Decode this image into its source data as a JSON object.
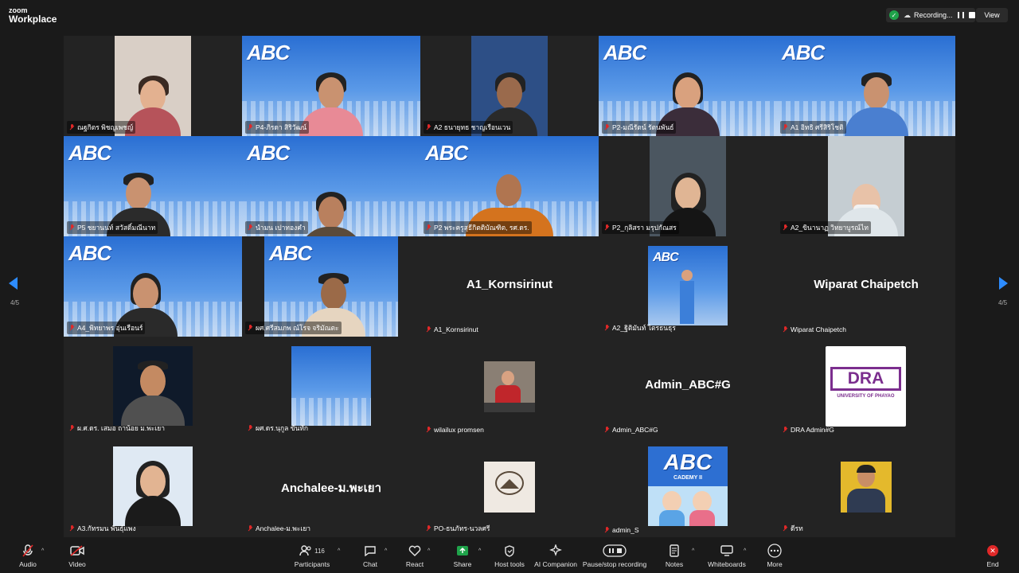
{
  "app": {
    "logo_top": "zoom",
    "logo_bottom": "Workplace"
  },
  "recording": {
    "label": "Recording...",
    "view_label": "View"
  },
  "pagination": {
    "left": "4/5",
    "right": "4/5"
  },
  "tiles": [
    {
      "name": "ณฐกิตร พิชญเพชญ์",
      "kind": "cam"
    },
    {
      "name": "P4-ภิรดา สิริวัฒน์",
      "kind": "abc"
    },
    {
      "name": "A2 ธนายุทธ ชาญเรือนเวน",
      "kind": "cam"
    },
    {
      "name": "P2-มณีรัตน์ รัตนพันธ์",
      "kind": "abc"
    },
    {
      "name": "A1 อิทธิ ศรีสิริโชติ",
      "kind": "abc"
    },
    {
      "name": "P5 ชยานนท์ สวัสดิ์มณีนาท",
      "kind": "abc"
    },
    {
      "name": "นำมน เปาทองคำ",
      "kind": "abc"
    },
    {
      "name": "P2 พระครูสุธีกิตติบัณฑิต, รศ.ดร.",
      "kind": "abc"
    },
    {
      "name": "P2_กุลิสรา มรุปกัณสร",
      "kind": "cam"
    },
    {
      "name": "A2_ขินานาฏ วิทยาบูรณ์ไท",
      "kind": "cam"
    },
    {
      "name": "A4_พิทยาพร อุ่นเรือนร์",
      "kind": "abc"
    },
    {
      "name": "ผศ.ศรีสมภพ ณ์โรจ จริมัณตะ",
      "kind": "abc"
    },
    {
      "name": "A1_Kornsirinut",
      "kind": "text",
      "big": "A1_Kornsirinut"
    },
    {
      "name": "A2_ฐิติมันท์ ไตรธนธุร",
      "kind": "small"
    },
    {
      "name": "Wiparat Chaipetch",
      "kind": "text",
      "big": "Wiparat Chaipetch"
    },
    {
      "name": "ผ.ศ.ดร. เสมอ ถาน้อย ม.พะเยา",
      "kind": "small"
    },
    {
      "name": "ผศ.ดร.นุกูล ขันทัก",
      "kind": "small"
    },
    {
      "name": "wilailux promsen",
      "kind": "small"
    },
    {
      "name": "Admin_ABC#G",
      "kind": "text",
      "big": "Admin_ABC#G"
    },
    {
      "name": "DRA Admin#G",
      "kind": "small"
    },
    {
      "name": "A3.กัทรมน พันธุ์แพง",
      "kind": "small"
    },
    {
      "name": "Anchalee-ม.พะเยา",
      "kind": "text",
      "big": "Anchalee-ม.พะเยา"
    },
    {
      "name": "PO-ธนภัทร-นวลศรี",
      "kind": "small"
    },
    {
      "name": "admin_S",
      "kind": "small"
    },
    {
      "name": "ดีรท",
      "kind": "small"
    }
  ],
  "logos": {
    "abc": "ABC",
    "dra": "DRA",
    "dra_sub": "UNIVERSITY OF PHAYAO",
    "abc2": "ABC",
    "abc2_sub": "CADEMY II"
  },
  "toolbar": {
    "audio": "Audio",
    "video": "Video",
    "participants": "Participants",
    "participant_count": "116",
    "chat": "Chat",
    "react": "React",
    "share": "Share",
    "host_tools": "Host tools",
    "ai": "AI Companion",
    "pause_rec": "Pause/stop recording",
    "notes": "Notes",
    "whiteboards": "Whiteboards",
    "more": "More",
    "end": "End"
  },
  "colors": {
    "accent": "#2d8cff",
    "end": "#e02828",
    "share": "#1fa34a",
    "shield": "#1fa34a"
  }
}
